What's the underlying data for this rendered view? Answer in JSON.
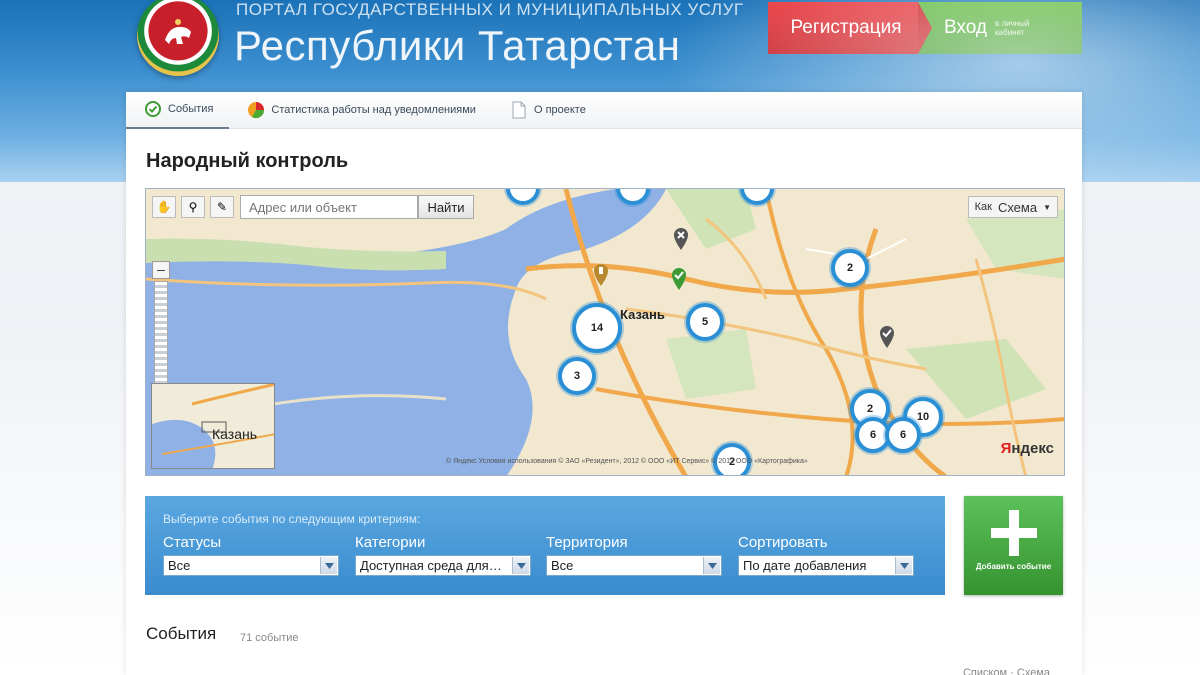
{
  "header": {
    "subtitle": "ПОРТАЛ ГОСУДАРСТВЕННЫХ И МУНИЦИПАЛЬНЫХ УСЛУГ",
    "title": "Республики Татарстан",
    "register_label": "Регистрация",
    "login_label": "Вход",
    "login_sub": "в личный кабинет",
    "emblem_icon": "tatarstan-emblem",
    "colors": {
      "register": "#d8262e",
      "login": "#4aab32"
    }
  },
  "tabs": [
    {
      "label": "События",
      "icon": "check-circle-icon",
      "active": true
    },
    {
      "label": "Статистика работы над уведомлениями",
      "icon": "pie-chart-icon",
      "active": false
    },
    {
      "label": "О проекте",
      "icon": "document-icon",
      "active": false
    }
  ],
  "page": {
    "title": "Народный контроль"
  },
  "map": {
    "search_placeholder": "Адрес или объект",
    "find_label": "Найти",
    "type_prefix": "Как",
    "type_selected": "Схема",
    "zoom_minus": "–",
    "city_label": "Казань",
    "minimap_label": "Казань",
    "logo_brand": "Я",
    "logo_rest": "ндекс",
    "copyright": "© Яндекс   Условия использования   © ЗАО «Резидент», 2012   © ООО «ИТ Сервис»   © 2012 ООО «Картографика»",
    "clusters": [
      {
        "count": "2"
      },
      {
        "count": "14"
      },
      {
        "count": "5"
      },
      {
        "count": "3"
      },
      {
        "count": "2"
      },
      {
        "count": "10"
      },
      {
        "count": "6"
      },
      {
        "count": "6"
      },
      {
        "count": "2"
      }
    ]
  },
  "filters": {
    "hint": "Выберите события по следующим критериям:",
    "groups": [
      {
        "label": "Статусы",
        "value": "Все"
      },
      {
        "label": "Категории",
        "value": "Доступная среда для…"
      },
      {
        "label": "Территория",
        "value": "Все"
      },
      {
        "label": "Сортировать",
        "value": "По дате добавления"
      }
    ]
  },
  "add_button": {
    "label": "Добавить событие"
  },
  "events": {
    "title": "События",
    "count": "71 событие"
  },
  "sort_links": {
    "text": "Списком   ·   Схема"
  }
}
